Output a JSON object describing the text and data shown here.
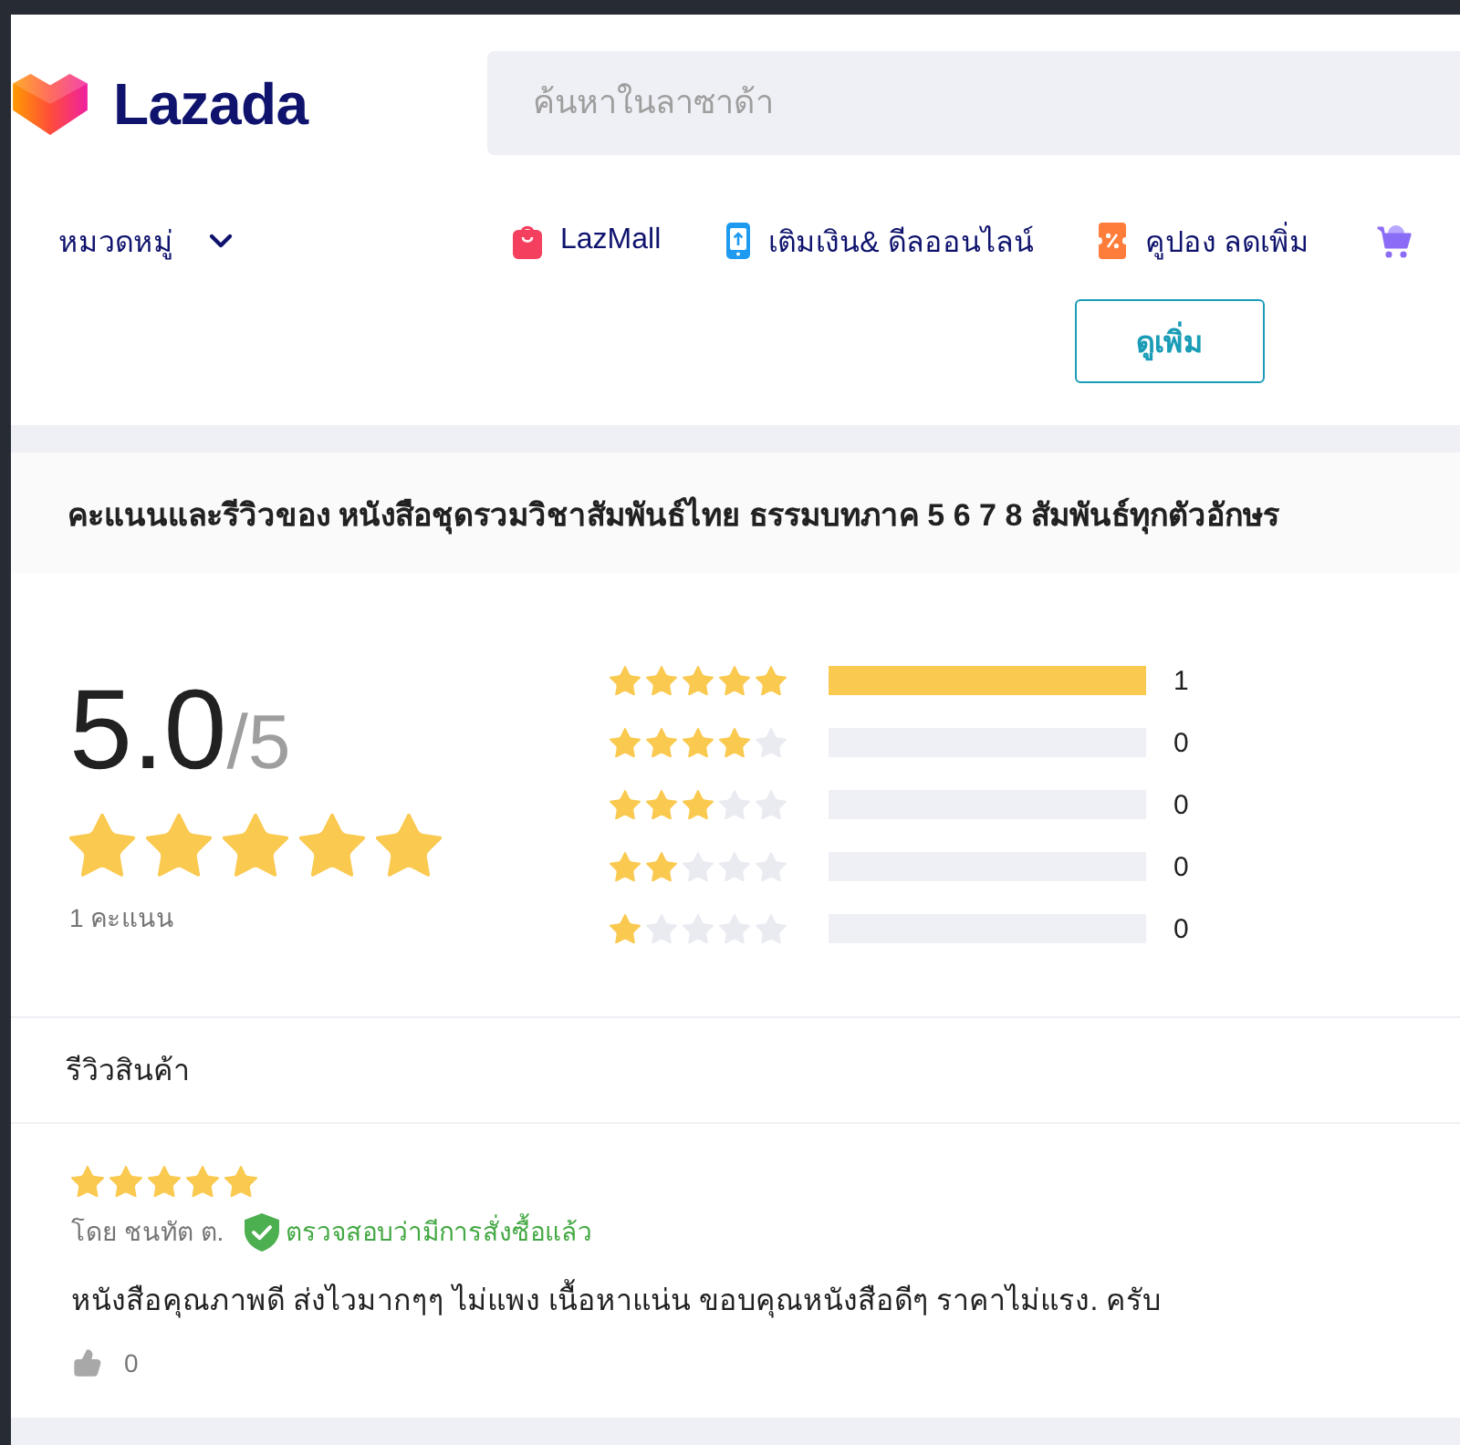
{
  "header": {
    "logo": "Lazada",
    "search": {
      "placeholder": "ค้นหาในลาซาด้า"
    },
    "category_menu": "หมวดหมู่",
    "nav_links": [
      {
        "kind": "lazmall",
        "label": "LazMall"
      },
      {
        "kind": "topup",
        "label": "เติมเงิน& ดีลออนไลน์"
      },
      {
        "kind": "coupon",
        "label": "คูปอง ลดเพิ่ม"
      },
      {
        "kind": "cart"
      }
    ],
    "more_button": "ดูเพิ่ม"
  },
  "ratings": {
    "title": "คะแนนและรีวิวของ หนังสือชุดรวมวิชาสัมพันธ์ไทย ธรรมบทภาค 5 6 7 8 สัมพันธ์ทุกตัวอักษร",
    "score": "5.0",
    "scale": "/5",
    "stars": 5,
    "count": "1 คะแนน",
    "breakdown": [
      {
        "stars": 5,
        "level": 1,
        "count": "1"
      },
      {
        "stars": 4,
        "level": 0,
        "count": "0"
      },
      {
        "stars": 3,
        "level": 0,
        "count": "0"
      },
      {
        "stars": 2,
        "level": 0,
        "count": "0"
      },
      {
        "stars": 1,
        "level": 0,
        "count": "0"
      }
    ]
  },
  "reviews": {
    "heading": "รีวิวสินค้า",
    "items": [
      {
        "stars": 5,
        "author": "โดย ชนทัต ต.",
        "verified": true,
        "verified_label": "ตรวจสอบว่ามีการสั่งซื้อแล้ว",
        "text": "หนังสือคุณภาพดี ส่งไวมากๆๆ ไม่แพง เนื้อหาแน่น ขอบคุณหนังสือดีๆ ราคาไม่แรง. ครับ",
        "likes": "0"
      }
    ]
  }
}
